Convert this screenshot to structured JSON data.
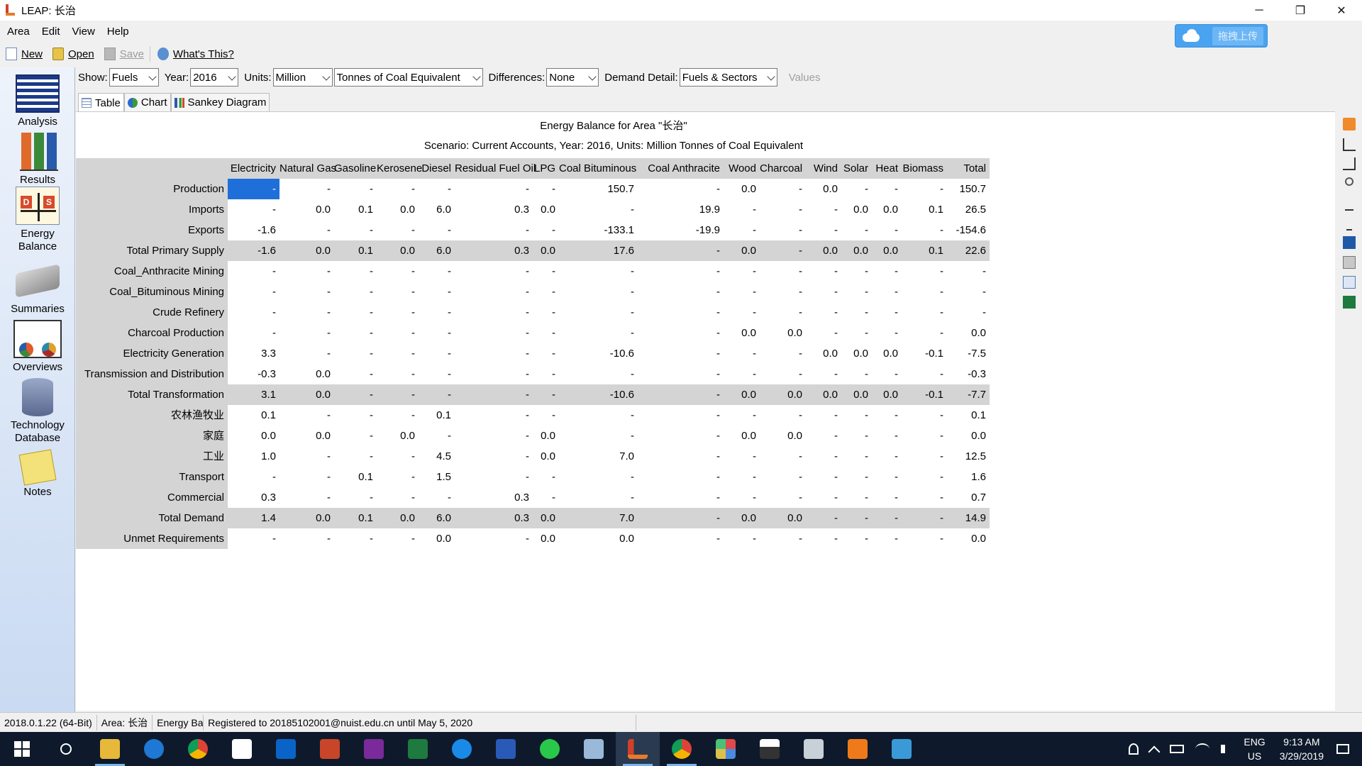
{
  "window": {
    "title": "LEAP: 长治",
    "controls": [
      "─",
      "❐",
      "✕"
    ]
  },
  "menu": [
    "Area",
    "Edit",
    "View",
    "Help"
  ],
  "upload_button": {
    "label": "拖拽上传"
  },
  "toolbar1": {
    "new": "New",
    "open": "Open",
    "save": "Save",
    "whats_this": "What's This?"
  },
  "sidebar": {
    "items": [
      {
        "label": "Analysis"
      },
      {
        "label": "Results"
      },
      {
        "label": "Energy\nBalance"
      },
      {
        "label": "Summaries"
      },
      {
        "label": "Overviews"
      },
      {
        "label": "Technology\nDatabase"
      },
      {
        "label": "Notes"
      }
    ]
  },
  "toolbar2": {
    "show_label": "Show:",
    "show_value": "Fuels",
    "year_label": "Year:",
    "year_value": "2016",
    "units_label": "Units:",
    "units_scale": "Million",
    "units_value": "Tonnes of Coal Equivalent",
    "diff_label": "Differences:",
    "diff_value": "None",
    "detail_label": "Demand Detail:",
    "detail_value": "Fuels & Sectors",
    "values_label": "Values"
  },
  "tabs": [
    "Table",
    "Chart",
    "Sankey Diagram"
  ],
  "report": {
    "title": "Energy Balance for Area \"长治\"",
    "subtitle": "Scenario: Current Accounts, Year: 2016, Units: Million Tonnes of Coal Equivalent"
  },
  "table": {
    "columns": [
      "Electricity",
      "Natural Gas",
      "Gasoline",
      "Kerosene",
      "Diesel",
      "Residual Fuel Oil",
      "LPG",
      "Coal Bituminous",
      "Coal Anthracite",
      "Wood",
      "Charcoal",
      "Wind",
      "Solar",
      "Heat",
      "Biomass",
      "Total"
    ],
    "rows": [
      {
        "label": "Production",
        "total": false,
        "values": [
          "-",
          "-",
          "-",
          "-",
          "-",
          "-",
          "-",
          "150.7",
          "-",
          "0.0",
          "-",
          "0.0",
          "-",
          "-",
          "-",
          "150.7"
        ]
      },
      {
        "label": "Imports",
        "total": false,
        "values": [
          "-",
          "0.0",
          "0.1",
          "0.0",
          "6.0",
          "0.3",
          "0.0",
          "-",
          "19.9",
          "-",
          "-",
          "-",
          "0.0",
          "0.0",
          "0.1",
          "26.5"
        ]
      },
      {
        "label": "Exports",
        "total": false,
        "values": [
          "-1.6",
          "-",
          "-",
          "-",
          "-",
          "-",
          "-",
          "-133.1",
          "-19.9",
          "-",
          "-",
          "-",
          "-",
          "-",
          "-",
          "-154.6"
        ]
      },
      {
        "label": "Total Primary Supply",
        "total": true,
        "values": [
          "-1.6",
          "0.0",
          "0.1",
          "0.0",
          "6.0",
          "0.3",
          "0.0",
          "17.6",
          "-",
          "0.0",
          "-",
          "0.0",
          "0.0",
          "0.0",
          "0.1",
          "22.6"
        ]
      },
      {
        "label": "Coal_Anthracite Mining",
        "total": false,
        "values": [
          "-",
          "-",
          "-",
          "-",
          "-",
          "-",
          "-",
          "-",
          "-",
          "-",
          "-",
          "-",
          "-",
          "-",
          "-",
          "-"
        ]
      },
      {
        "label": "Coal_Bituminous Mining",
        "total": false,
        "values": [
          "-",
          "-",
          "-",
          "-",
          "-",
          "-",
          "-",
          "-",
          "-",
          "-",
          "-",
          "-",
          "-",
          "-",
          "-",
          "-"
        ]
      },
      {
        "label": "Crude Refinery",
        "total": false,
        "values": [
          "-",
          "-",
          "-",
          "-",
          "-",
          "-",
          "-",
          "-",
          "-",
          "-",
          "-",
          "-",
          "-",
          "-",
          "-",
          "-"
        ]
      },
      {
        "label": "Charcoal Production",
        "total": false,
        "values": [
          "-",
          "-",
          "-",
          "-",
          "-",
          "-",
          "-",
          "-",
          "-",
          "0.0",
          "0.0",
          "-",
          "-",
          "-",
          "-",
          "0.0"
        ]
      },
      {
        "label": "Electricity Generation",
        "total": false,
        "values": [
          "3.3",
          "-",
          "-",
          "-",
          "-",
          "-",
          "-",
          "-10.6",
          "-",
          "-",
          "-",
          "0.0",
          "0.0",
          "0.0",
          "-0.1",
          "-7.5"
        ]
      },
      {
        "label": "Transmission and Distribution",
        "total": false,
        "values": [
          "-0.3",
          "0.0",
          "-",
          "-",
          "-",
          "-",
          "-",
          "-",
          "-",
          "-",
          "-",
          "-",
          "-",
          "-",
          "-",
          "-0.3"
        ]
      },
      {
        "label": "Total Transformation",
        "total": true,
        "values": [
          "3.1",
          "0.0",
          "-",
          "-",
          "-",
          "-",
          "-",
          "-10.6",
          "-",
          "0.0",
          "0.0",
          "0.0",
          "0.0",
          "0.0",
          "-0.1",
          "-7.7"
        ]
      },
      {
        "label": "农林渔牧业",
        "total": false,
        "values": [
          "0.1",
          "-",
          "-",
          "-",
          "0.1",
          "-",
          "-",
          "-",
          "-",
          "-",
          "-",
          "-",
          "-",
          "-",
          "-",
          "0.1"
        ]
      },
      {
        "label": "家庭",
        "total": false,
        "values": [
          "0.0",
          "0.0",
          "-",
          "0.0",
          "-",
          "-",
          "0.0",
          "-",
          "-",
          "0.0",
          "0.0",
          "-",
          "-",
          "-",
          "-",
          "0.0"
        ]
      },
      {
        "label": "工业",
        "total": false,
        "values": [
          "1.0",
          "-",
          "-",
          "-",
          "4.5",
          "-",
          "0.0",
          "7.0",
          "-",
          "-",
          "-",
          "-",
          "-",
          "-",
          "-",
          "12.5"
        ]
      },
      {
        "label": "Transport",
        "total": false,
        "values": [
          "-",
          "-",
          "0.1",
          "-",
          "1.5",
          "-",
          "-",
          "-",
          "-",
          "-",
          "-",
          "-",
          "-",
          "-",
          "-",
          "1.6"
        ]
      },
      {
        "label": "Commercial",
        "total": false,
        "values": [
          "0.3",
          "-",
          "-",
          "-",
          "-",
          "0.3",
          "-",
          "-",
          "-",
          "-",
          "-",
          "-",
          "-",
          "-",
          "-",
          "0.7"
        ]
      },
      {
        "label": "Total Demand",
        "total": true,
        "values": [
          "1.4",
          "0.0",
          "0.1",
          "0.0",
          "6.0",
          "0.3",
          "0.0",
          "7.0",
          "-",
          "0.0",
          "0.0",
          "-",
          "-",
          "-",
          "-",
          "14.9"
        ]
      },
      {
        "label": "Unmet Requirements",
        "total": false,
        "values": [
          "-",
          "-",
          "-",
          "-",
          "0.0",
          "-",
          "0.0",
          "0.0",
          "-",
          "-",
          "-",
          "-",
          "-",
          "-",
          "-",
          "0.0"
        ]
      }
    ]
  },
  "statusbar": {
    "version": "2018.0.1.22 (64-Bit)",
    "area": "Area: 长治",
    "view": "Energy Ba",
    "registration": "Registered to 20185102001@nuist.edu.cn until May 5, 2020"
  },
  "taskbar": {
    "apps": [
      "start",
      "search",
      "file-explorer",
      "edge",
      "chrome",
      "store",
      "outlook",
      "powerpoint",
      "onenote",
      "excel",
      "sogou",
      "word",
      "wechat",
      "paint",
      "leap",
      "chrome-2",
      "app-grid",
      "photos",
      "app-window",
      "app-rocket",
      "app-screen"
    ],
    "lang_top": "ENG",
    "lang_bottom": "US",
    "time": "9:13 AM",
    "date": "3/29/2019"
  }
}
